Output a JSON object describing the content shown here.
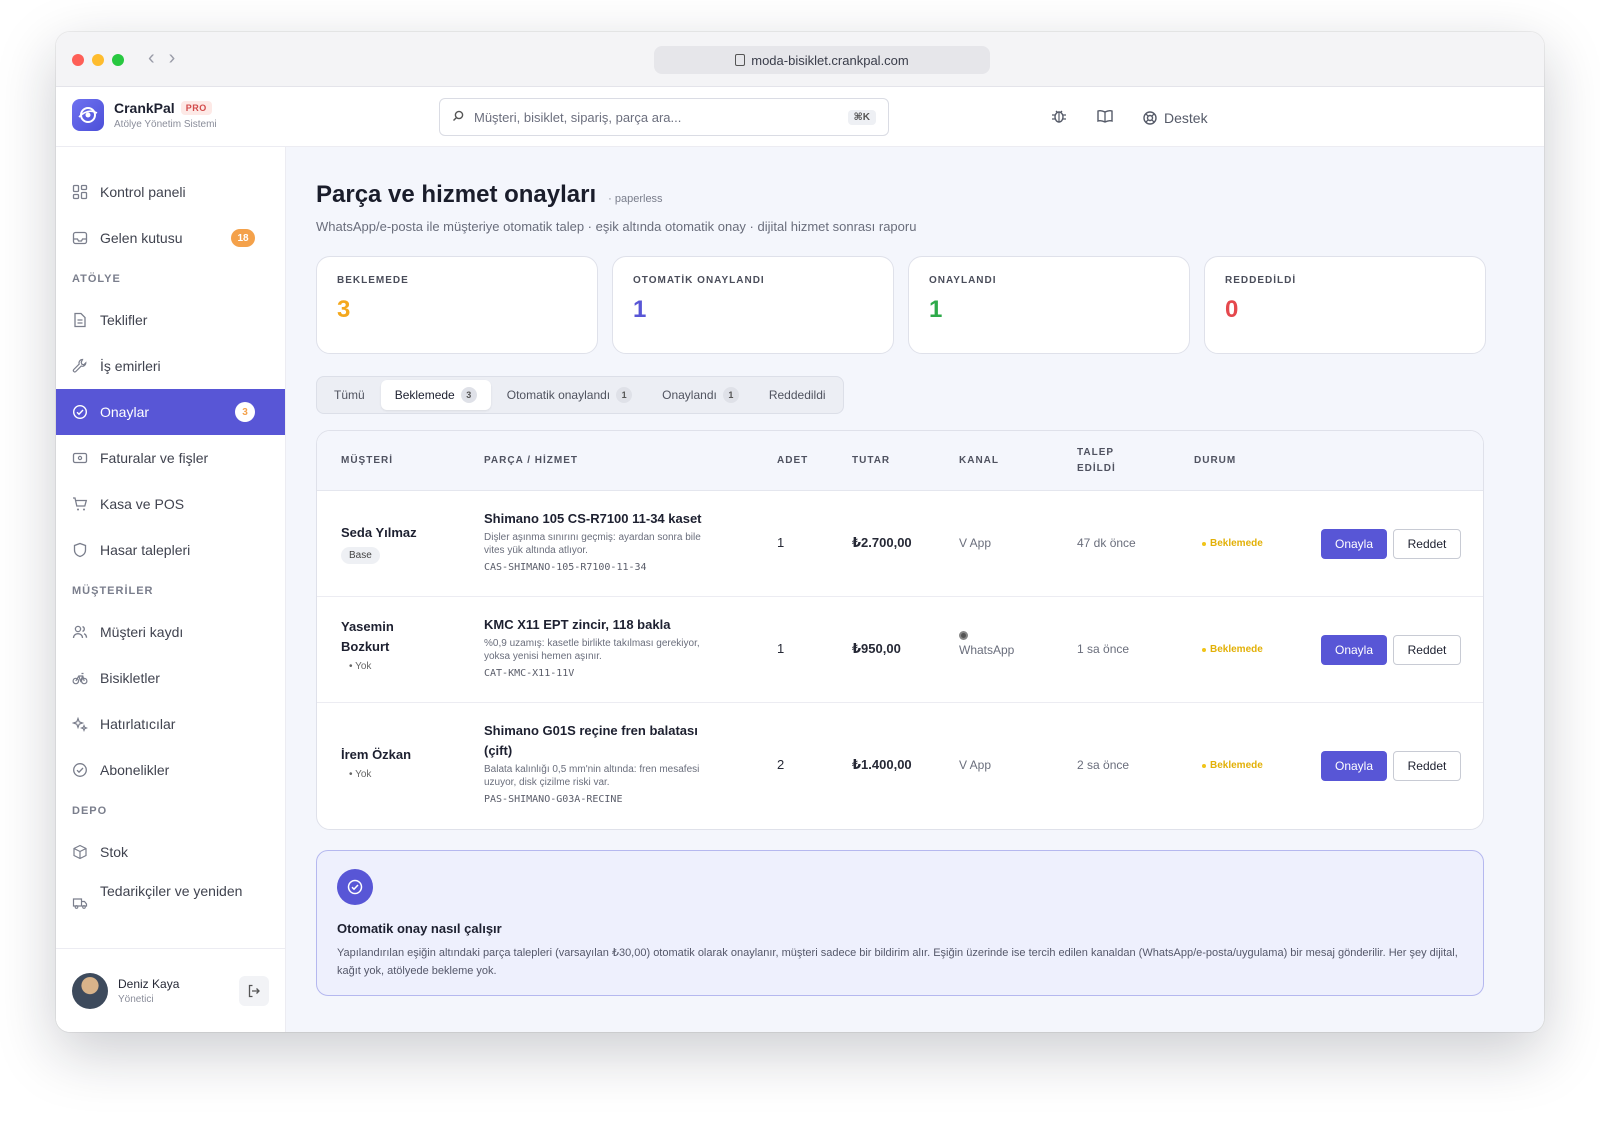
{
  "browser": {
    "url": "moda-bisiklet.crankpal.com"
  },
  "brand": {
    "name": "CrankPal",
    "badge": "PRO",
    "subtitle": "Atölye Yönetim Sistemi"
  },
  "search": {
    "placeholder": "Müşteri, bisiklet, sipariş, parça ara...",
    "shortcut": "⌘K"
  },
  "header": {
    "support_label": "Destek"
  },
  "sidebar": {
    "top": [
      {
        "label": "Kontrol paneli"
      },
      {
        "label": "Gelen kutusu",
        "badge": "18"
      }
    ],
    "sections": [
      {
        "title": "ATÖLYE",
        "items": [
          {
            "label": "Teklifler"
          },
          {
            "label": "İş emirleri"
          },
          {
            "label": "Onaylar",
            "badge": "3"
          },
          {
            "label": "Faturalar ve fişler"
          },
          {
            "label": "Kasa ve POS"
          },
          {
            "label": "Hasar talepleri"
          }
        ]
      },
      {
        "title": "MÜŞTERİLER",
        "items": [
          {
            "label": "Müşteri kaydı"
          },
          {
            "label": "Bisikletler"
          },
          {
            "label": "Hatırlatıcılar"
          },
          {
            "label": "Abonelikler"
          }
        ]
      },
      {
        "title": "DEPO",
        "items": [
          {
            "label": "Stok"
          },
          {
            "label": "Tedarikçiler ve yeniden"
          }
        ]
      }
    ],
    "user": {
      "name": "Deniz Kaya",
      "role": "Yönetici"
    }
  },
  "page": {
    "title": "Parça ve hizmet onayları",
    "tag": "· paperless",
    "subtitle": "WhatsApp/e-posta ile müşteriye otomatik talep · eşik altında otomatik onay · dijital hizmet sonrası raporu"
  },
  "stats": [
    {
      "label": "BEKLEMEDE",
      "value": "3",
      "color": "#f4a81d"
    },
    {
      "label": "OTOMATİK ONAYLANDI",
      "value": "1",
      "color": "#5856d6"
    },
    {
      "label": "ONAYLANDI",
      "value": "1",
      "color": "#2eaa4a"
    },
    {
      "label": "REDDEDİLDİ",
      "value": "0",
      "color": "#e5484d"
    }
  ],
  "tabs": [
    {
      "label": "Tümü",
      "count": null
    },
    {
      "label": "Beklemede",
      "count": "3"
    },
    {
      "label": "Otomatik onaylandı",
      "count": "1"
    },
    {
      "label": "Onaylandı",
      "count": "1"
    },
    {
      "label": "Reddedildi",
      "count": null
    }
  ],
  "table": {
    "headers": {
      "customer": "MÜŞTERİ",
      "part": "PARÇA / HİZMET",
      "qty": "ADET",
      "amount": "TUTAR",
      "channel": "KANAL",
      "requested_1": "TALEP",
      "requested_2": "EDİLDİ",
      "status": "DURUM"
    },
    "rows": [
      {
        "customer_line1": "Seda Yılmaz",
        "customer_line2": "",
        "customer_meta": "Base",
        "part_name_1": "Shimano 105 CS-R7100 11-34 kaset",
        "part_name_2": "",
        "part_desc_1": "Dişler aşınma sınırını geçmiş: ayardan sonra bile",
        "part_desc_2": "vites yük altında atlıyor.",
        "sku": "CAS-SHIMANO-105-R7100-11-34",
        "qty": "1",
        "amount": "₺2.700,00",
        "channel": "V App",
        "requested": "47 dk önce",
        "status": "Beklemede",
        "approve_label": "Onayla",
        "reject_label": "Reddet"
      },
      {
        "customer_line1": "Yasemin",
        "customer_line2": "Bozkurt",
        "customer_meta": "Yok",
        "part_name_1": "KMC X11 EPT zincir, 118 bakla",
        "part_name_2": "",
        "part_desc_1": "%0,9 uzamış: kasetle birlikte takılması gerekiyor,",
        "part_desc_2": "yoksa yenisi hemen aşınır.",
        "sku": "CAT-KMC-X11-11V",
        "qty": "1",
        "amount": "₺950,00",
        "channel": "WhatsApp",
        "requested": "1 sa önce",
        "status": "Beklemede",
        "approve_label": "Onayla",
        "reject_label": "Reddet"
      },
      {
        "customer_line1": "İrem Özkan",
        "customer_line2": "",
        "customer_meta": "Yok",
        "part_name_1": "Shimano G01S reçine fren balatası",
        "part_name_2": "(çift)",
        "part_desc_1": "Balata kalınlığı 0,5 mm'nin altında: fren mesafesi",
        "part_desc_2": "uzuyor, disk çizilme riski var.",
        "sku": "PAS-SHIMANO-G03A-RECINE",
        "qty": "2",
        "amount": "₺1.400,00",
        "channel": "V App",
        "requested": "2 sa önce",
        "status": "Beklemede",
        "approve_label": "Onayla",
        "reject_label": "Reddet"
      }
    ]
  },
  "info": {
    "title": "Otomatik onay nasıl çalışır",
    "text": "Yapılandırılan eşiğin altındaki parça talepleri (varsayılan ₺30,00) otomatik olarak onaylanır, müşteri sadece bir bildirim alır. Eşiğin üzerinde ise tercih edilen kanaldan (WhatsApp/e-posta/uygulama) bir mesaj gönderilir. Her şey dijital, kağıt yok, atölyede bekleme yok."
  },
  "colors": {
    "accent": "#5856d6",
    "pending": "#e2b007",
    "badge": "#f4a14a"
  }
}
